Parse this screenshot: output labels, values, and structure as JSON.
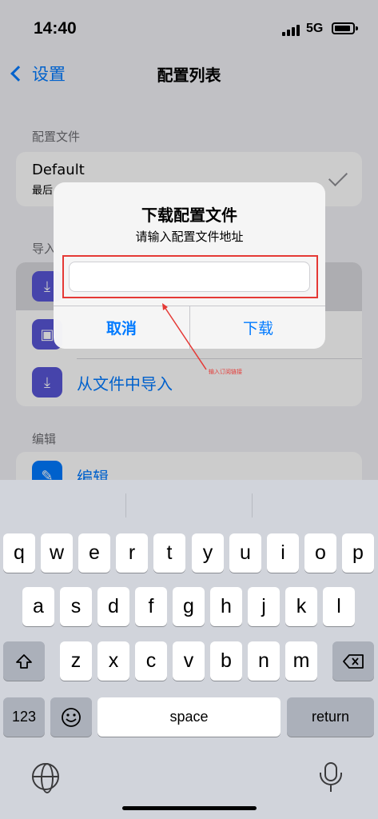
{
  "status_bar": {
    "time": "14:40",
    "network": "5G"
  },
  "nav": {
    "back_label": "设置",
    "title": "配置列表"
  },
  "sections": {
    "config_header": "配置文件",
    "import_header": "导入",
    "edit_header": "编辑"
  },
  "config": {
    "name": "Default",
    "subtitle": "最后"
  },
  "import_items": [
    {
      "label": "",
      "icon": "download-icon"
    },
    {
      "label": "",
      "icon": "qr-scan-icon"
    },
    {
      "label": "从文件中导入",
      "icon": "file-import-icon"
    }
  ],
  "edit_items": [
    {
      "label": "编辑",
      "icon": "edit-icon"
    }
  ],
  "alert": {
    "title": "下载配置文件",
    "message": "请输入配置文件地址",
    "input_value": "",
    "cancel_label": "取消",
    "confirm_label": "下载"
  },
  "annotation": {
    "text": "输入订阅链接",
    "color": "#e53935"
  },
  "keyboard": {
    "row1": [
      "q",
      "w",
      "e",
      "r",
      "t",
      "y",
      "u",
      "i",
      "o",
      "p"
    ],
    "row2": [
      "a",
      "s",
      "d",
      "f",
      "g",
      "h",
      "j",
      "k",
      "l"
    ],
    "row3": [
      "z",
      "x",
      "c",
      "v",
      "b",
      "n",
      "m"
    ],
    "numbers_label": "123",
    "space_label": "space",
    "return_label": "return",
    "shift_icon": "shift-icon",
    "delete_icon": "delete-icon",
    "emoji_icon": "emoji-icon",
    "globe_icon": "globe-icon",
    "mic_icon": "microphone-icon"
  },
  "colors": {
    "accent": "#007aff",
    "icon_purple": "#5856d6",
    "annotation_red": "#e53935"
  }
}
